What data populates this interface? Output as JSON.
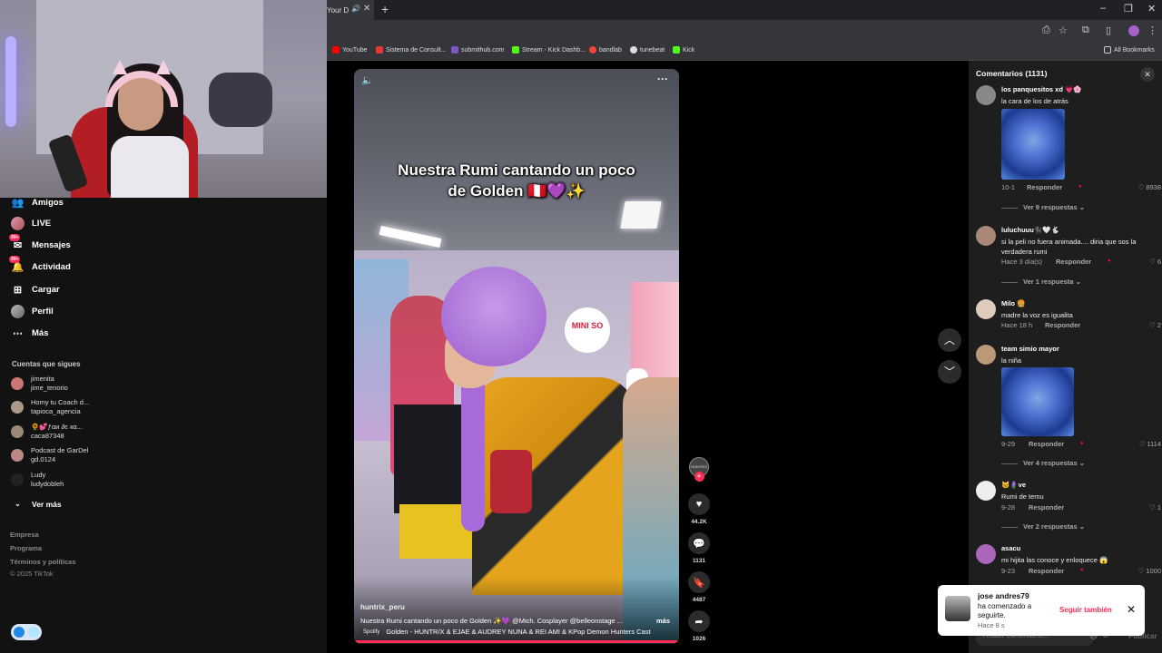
{
  "browser": {
    "tab_title": "Your D",
    "bookmarks": [
      {
        "label": "YouTube",
        "color": "#ff0000"
      },
      {
        "label": "Sistema de Consult...",
        "color": "#e53935"
      },
      {
        "label": "submithub.com",
        "color": "#7e57c2"
      },
      {
        "label": "Stream - Kick Dashb...",
        "color": "#53fc18"
      },
      {
        "label": "bandlab",
        "color": "#f44336"
      },
      {
        "label": "tunebeat",
        "color": "#dddddd"
      },
      {
        "label": "Kick",
        "color": "#53fc18"
      }
    ],
    "all_bookmarks": "All Bookmarks"
  },
  "sidebar": {
    "nav": [
      {
        "label": "Amigos",
        "icon": "friends-icon"
      },
      {
        "label": "LIVE",
        "icon": "live-icon"
      },
      {
        "label": "Mensajes",
        "icon": "messages-icon",
        "badge": "99+"
      },
      {
        "label": "Actividad",
        "icon": "activity-icon",
        "badge": "99+"
      },
      {
        "label": "Cargar",
        "icon": "upload-icon"
      },
      {
        "label": "Perfil",
        "icon": "profile-icon"
      },
      {
        "label": "Más",
        "icon": "more-icon"
      }
    ],
    "following_title": "Cuentas que sigues",
    "accounts": [
      {
        "name": "jimenita",
        "handle": "jime_tenorio",
        "color": "#c77"
      },
      {
        "name": "Homy tu Coach d...",
        "handle": "tapioca_agencia",
        "color": "#a98"
      },
      {
        "name": "🌻💕ƒαи ∂є кα...",
        "handle": "caca87348",
        "color": "#987"
      },
      {
        "name": "Podcast de GarDel",
        "handle": "gd.0124",
        "color": "#b88"
      },
      {
        "name": "Ludy",
        "handle": "ludydobleh",
        "color": "#222"
      }
    ],
    "see_more": "Ver más",
    "footer": [
      "Empresa",
      "Programa",
      "Términos y políticas",
      "© 2025 TikTok"
    ]
  },
  "video": {
    "caption": "Nuestra Rumi cantando un poco de Golden 🇵🇪💜✨",
    "author": "huntrix_peru",
    "description": "Nuestra Rumi cantando un poco de Golden ✨💜 @Mich. Cosplayer  @belleonstage ...",
    "more": "más",
    "spotify": "Spotify",
    "music": "Golden - HUNTR/X & EJAE & AUDREY NUNA & REI AMI & KPop Demon Hunters Cast",
    "store_logo": "MINI SO"
  },
  "actions": {
    "likes": "44.2K",
    "comments": "1131",
    "saves": "4487",
    "shares": "1026"
  },
  "comments_panel": {
    "title": "Comentarios (1131)",
    "comments": [
      {
        "user": "los panquesitos xd 💗🌸",
        "text": "la cara de los de atrás",
        "meta": "10-1",
        "reply": "Responder",
        "likes": "8938",
        "more": "Ver 9 respuestas ⌄",
        "color": "#888"
      },
      {
        "user": "luluchuuu🐈‍⬛🤍🐇",
        "text": "si la peli no fuera animada.... diria que sos la verdadera rumi",
        "meta": "Hace 3 día(s)",
        "reply": "Responder",
        "likes": "6",
        "more": "Ver 1 respuesta ⌄",
        "color": "#a87"
      },
      {
        "user": "Milo 🍔",
        "text": "madre la voz es igualita",
        "meta": "Hace 18 h",
        "reply": "Responder",
        "likes": "2",
        "color": "#dcb"
      },
      {
        "user": "team simio mayor",
        "text": "la niña",
        "meta": "9-29",
        "reply": "Responder",
        "likes": "1114",
        "more": "Ver 4 respuestas ⌄",
        "color": "#b97"
      },
      {
        "user": "🐱🪻ve",
        "text": "Rumi de temu",
        "meta": "9-28",
        "reply": "Responder",
        "likes": "1",
        "more": "Ver 2 respuestas ⌄",
        "color": "#eee"
      },
      {
        "user": "asacu",
        "text": "mi hijita las conoce y enloquece 😱",
        "meta": "9-23",
        "reply": "Responder",
        "likes": "1000",
        "color": "#a6b"
      }
    ],
    "input_placeholder": "Añadir comentario...",
    "post": "Publicar"
  },
  "toast": {
    "user": "jose andres79",
    "message": "ha comenzado a seguirte.",
    "time": "Hace 8 s",
    "follow_back": "Seguir también"
  }
}
